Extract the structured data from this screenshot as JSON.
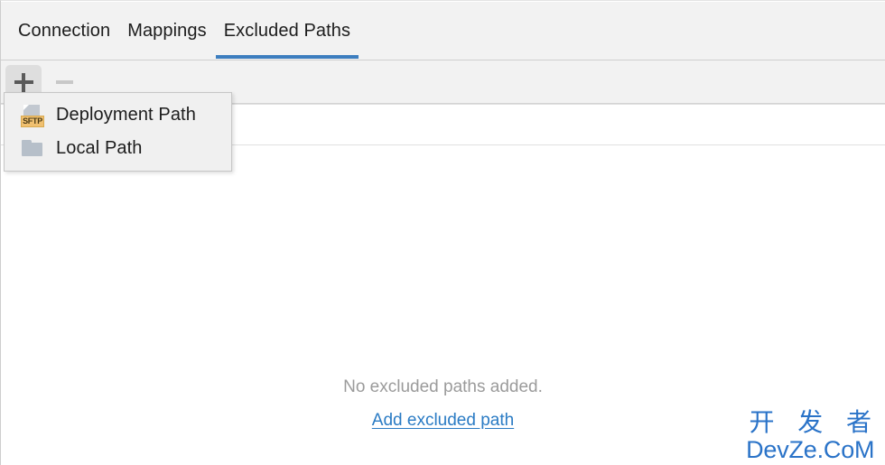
{
  "window": {
    "tabs": [
      {
        "label": "Connection",
        "selected": false
      },
      {
        "label": "Mappings",
        "selected": false
      },
      {
        "label": "Excluded Paths",
        "selected": true
      }
    ],
    "accent_color": "#3d7ebf"
  },
  "toolbar": {
    "add_button": {
      "icon": "plus-icon",
      "label": "+",
      "state": "pressed"
    },
    "remove_button": {
      "icon": "minus-icon",
      "label": "−",
      "state": "disabled"
    }
  },
  "add_menu": {
    "visible": true,
    "items": [
      {
        "label": "Deployment Path",
        "icon": "sftp-deployment-icon",
        "badge_text": "SFTP"
      },
      {
        "label": "Local Path",
        "icon": "folder-icon"
      }
    ]
  },
  "empty_state": {
    "message": "No excluded paths added.",
    "link_label": "Add excluded path",
    "link_color": "#2a7bc4",
    "message_color": "#9b9b9b"
  },
  "watermark": {
    "line1": "开 发 者",
    "line2": "DevZe.CoM",
    "color": "#2a73c8"
  }
}
